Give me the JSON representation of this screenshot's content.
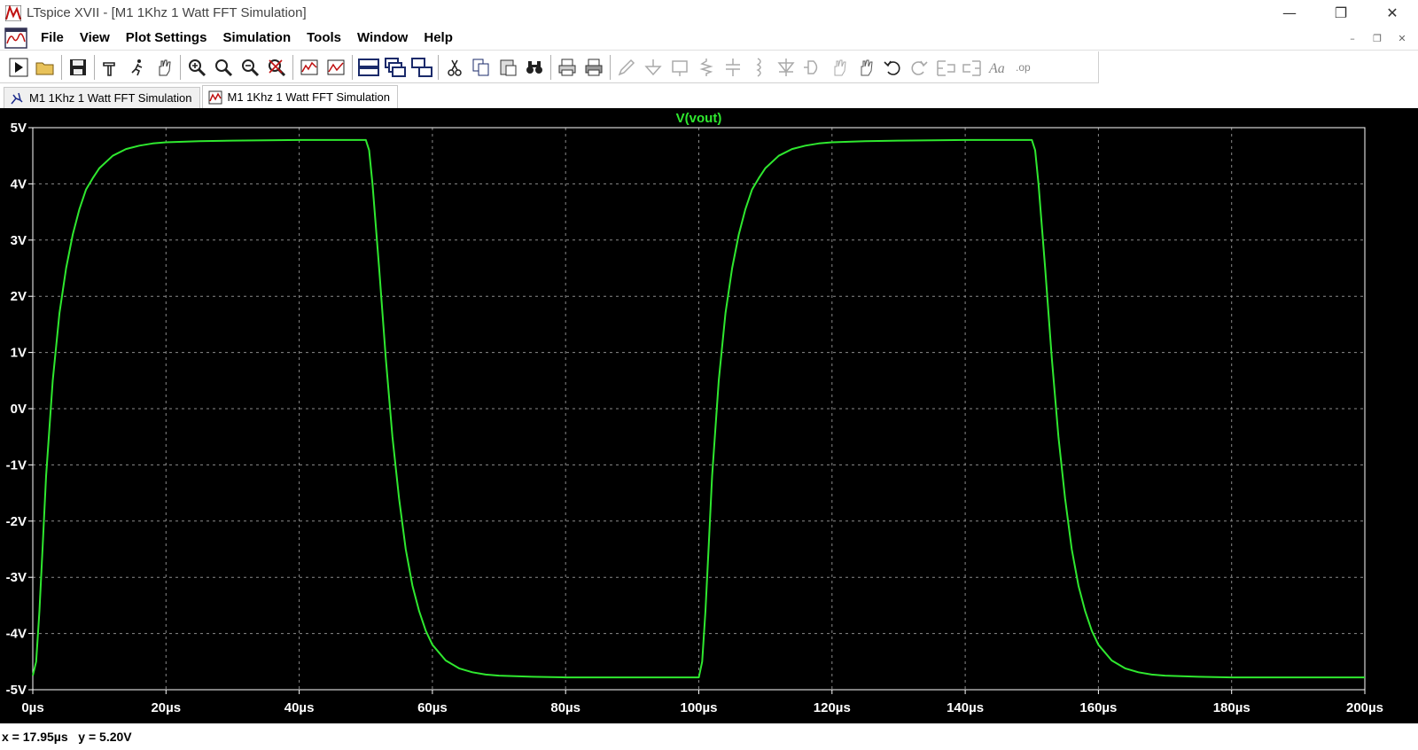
{
  "window": {
    "title": "LTspice XVII - [M1 1Khz 1 Watt FFT Simulation]",
    "minimize": "—",
    "restore": "❐",
    "close": "✕"
  },
  "menu": {
    "items": [
      "File",
      "View",
      "Plot Settings",
      "Simulation",
      "Tools",
      "Window",
      "Help"
    ]
  },
  "mdi": {
    "minimize": "–",
    "restore": "❐",
    "close": "✕"
  },
  "tabs": [
    {
      "label": "M1 1Khz 1 Watt FFT Simulation",
      "icon": "schematic-icon",
      "active": false
    },
    {
      "label": "M1 1Khz 1 Watt FFT Simulation",
      "icon": "waveform-icon",
      "active": true
    }
  ],
  "status": {
    "text": "x = 17.95µs   y = 5.20V"
  },
  "colors": {
    "trace": "#2fe82f",
    "grid": "#8a8a8a",
    "axis_text": "#ffffff",
    "background": "#000000"
  },
  "chart_data": {
    "type": "line",
    "title": "V(vout)",
    "xlabel": "",
    "ylabel": "",
    "xlim": [
      0,
      200
    ],
    "ylim": [
      -5,
      5
    ],
    "x_ticks": [
      "0µs",
      "20µs",
      "40µs",
      "60µs",
      "80µs",
      "100µs",
      "120µs",
      "140µs",
      "160µs",
      "180µs",
      "200µs"
    ],
    "y_ticks": [
      "5V",
      "4V",
      "3V",
      "2V",
      "1V",
      "0V",
      "-1V",
      "-2V",
      "-3V",
      "-4V",
      "-5V"
    ],
    "grid": true,
    "series": [
      {
        "name": "V(vout)",
        "x": [
          0,
          0.5,
          1,
          1.5,
          2,
          3,
          4,
          5,
          6,
          7,
          8,
          9,
          10,
          12,
          14,
          16,
          18,
          20,
          25,
          30,
          40,
          50,
          50.5,
          51,
          52,
          53,
          54,
          55,
          56,
          57,
          58,
          59,
          60,
          62,
          64,
          66,
          68,
          70,
          75,
          80,
          90,
          100,
          100.5,
          101,
          101.5,
          102,
          103,
          104,
          105,
          106,
          107,
          108,
          109,
          110,
          112,
          114,
          116,
          118,
          120,
          125,
          130,
          140,
          150,
          150.5,
          151,
          152,
          153,
          154,
          155,
          156,
          157,
          158,
          159,
          160,
          162,
          164,
          166,
          168,
          170,
          175,
          180,
          190,
          200
        ],
        "y": [
          -4.75,
          -4.5,
          -3.6,
          -2.4,
          -1.2,
          0.5,
          1.7,
          2.5,
          3.1,
          3.55,
          3.9,
          4.1,
          4.28,
          4.5,
          4.62,
          4.68,
          4.72,
          4.74,
          4.76,
          4.77,
          4.78,
          4.78,
          4.6,
          4.0,
          2.5,
          0.9,
          -0.5,
          -1.6,
          -2.5,
          -3.15,
          -3.6,
          -3.95,
          -4.2,
          -4.48,
          -4.62,
          -4.69,
          -4.73,
          -4.75,
          -4.77,
          -4.78,
          -4.78,
          -4.78,
          -4.5,
          -3.6,
          -2.4,
          -1.2,
          0.5,
          1.7,
          2.5,
          3.1,
          3.55,
          3.9,
          4.1,
          4.28,
          4.5,
          4.62,
          4.68,
          4.72,
          4.74,
          4.76,
          4.77,
          4.78,
          4.78,
          4.6,
          4.0,
          2.5,
          0.9,
          -0.5,
          -1.6,
          -2.5,
          -3.15,
          -3.6,
          -3.95,
          -4.2,
          -4.48,
          -4.62,
          -4.69,
          -4.73,
          -4.75,
          -4.77,
          -4.78,
          -4.78,
          -4.78
        ]
      }
    ]
  }
}
